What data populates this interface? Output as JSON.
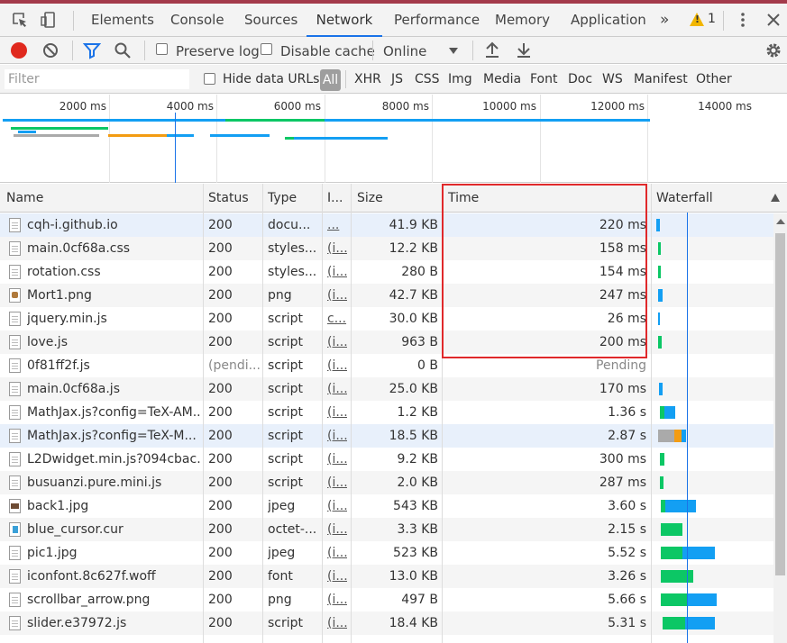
{
  "tabs": [
    "Elements",
    "Console",
    "Sources",
    "Network",
    "Performance",
    "Memory",
    "Application"
  ],
  "active_tab": "Network",
  "more_tabs_icon": "»",
  "warning_count": "1",
  "toolbar": {
    "preserve_log": "Preserve log",
    "disable_cache": "Disable cache",
    "throttle": "Online"
  },
  "filter": {
    "placeholder": "Filter",
    "hide_data_urls": "Hide data URLs",
    "types": [
      "All",
      "XHR",
      "JS",
      "CSS",
      "Img",
      "Media",
      "Font",
      "Doc",
      "WS",
      "Manifest",
      "Other"
    ]
  },
  "overview_ticks": [
    "2000 ms",
    "4000 ms",
    "6000 ms",
    "8000 ms",
    "10000 ms",
    "12000 ms",
    "14000 ms"
  ],
  "columns": {
    "name": "Name",
    "status": "Status",
    "type": "Type",
    "initiator": "I...",
    "size": "Size",
    "time": "Time",
    "waterfall": "Waterfall"
  },
  "colors": {
    "accent": "#1a73e8",
    "highlight_box": "#e0292b",
    "waterfall_green": "#0cc765",
    "waterfall_blue": "#139ff3",
    "record": "#e0291e"
  },
  "rows": [
    {
      "name": "cqh-i.github.io",
      "status": "200",
      "type": "docu...",
      "initiator": "...",
      "size": "41.9 KB",
      "time": "220 ms",
      "icon": "doc"
    },
    {
      "name": "main.0cf68a.css",
      "status": "200",
      "type": "styles...",
      "initiator": "(i...",
      "size": "12.2 KB",
      "time": "158 ms",
      "icon": "doc"
    },
    {
      "name": "rotation.css",
      "status": "200",
      "type": "styles...",
      "initiator": "(i...",
      "size": "280 B",
      "time": "154 ms",
      "icon": "doc"
    },
    {
      "name": "Mort1.png",
      "status": "200",
      "type": "png",
      "initiator": "(i...",
      "size": "42.7 KB",
      "time": "247 ms",
      "icon": "img"
    },
    {
      "name": "jquery.min.js",
      "status": "200",
      "type": "script",
      "initiator": "c...",
      "size": "30.0 KB",
      "time": "26 ms",
      "icon": "doc"
    },
    {
      "name": "love.js",
      "status": "200",
      "type": "script",
      "initiator": "(i...",
      "size": "963 B",
      "time": "200 ms",
      "icon": "doc"
    },
    {
      "name": "0f81ff2f.js",
      "status": "(pendi...",
      "type": "script",
      "initiator": "(i...",
      "size": "0 B",
      "time": "Pending",
      "icon": "doc"
    },
    {
      "name": "main.0cf68a.js",
      "status": "200",
      "type": "script",
      "initiator": "(i...",
      "size": "25.0 KB",
      "time": "170 ms",
      "icon": "doc"
    },
    {
      "name": "MathJax.js?config=TeX-AM...",
      "status": "200",
      "type": "script",
      "initiator": "(i...",
      "size": "1.2 KB",
      "time": "1.36 s",
      "icon": "doc"
    },
    {
      "name": "MathJax.js?config=TeX-M...",
      "status": "200",
      "type": "script",
      "initiator": "(i...",
      "size": "18.5 KB",
      "time": "2.87 s",
      "icon": "doc"
    },
    {
      "name": "L2Dwidget.min.js?094cbac...",
      "status": "200",
      "type": "script",
      "initiator": "(i...",
      "size": "9.2 KB",
      "time": "300 ms",
      "icon": "doc"
    },
    {
      "name": "busuanzi.pure.mini.js",
      "status": "200",
      "type": "script",
      "initiator": "(i...",
      "size": "2.0 KB",
      "time": "287 ms",
      "icon": "doc"
    },
    {
      "name": "back1.jpg",
      "status": "200",
      "type": "jpeg",
      "initiator": "(i...",
      "size": "543 KB",
      "time": "3.60 s",
      "icon": "jpg"
    },
    {
      "name": "blue_cursor.cur",
      "status": "200",
      "type": "octet-...",
      "initiator": "(i...",
      "size": "3.3 KB",
      "time": "2.15 s",
      "icon": "cur"
    },
    {
      "name": "pic1.jpg",
      "status": "200",
      "type": "jpeg",
      "initiator": "(i...",
      "size": "523 KB",
      "time": "5.52 s",
      "icon": "doc"
    },
    {
      "name": "iconfont.8c627f.woff",
      "status": "200",
      "type": "font",
      "initiator": "(i...",
      "size": "13.0 KB",
      "time": "3.26 s",
      "icon": "doc"
    },
    {
      "name": "scrollbar_arrow.png",
      "status": "200",
      "type": "png",
      "initiator": "(i...",
      "size": "497 B",
      "time": "5.66 s",
      "icon": "doc"
    },
    {
      "name": "slider.e37972.js",
      "status": "200",
      "type": "script",
      "initiator": "(i...",
      "size": "18.4 KB",
      "time": "5.31 s",
      "icon": "doc"
    }
  ]
}
